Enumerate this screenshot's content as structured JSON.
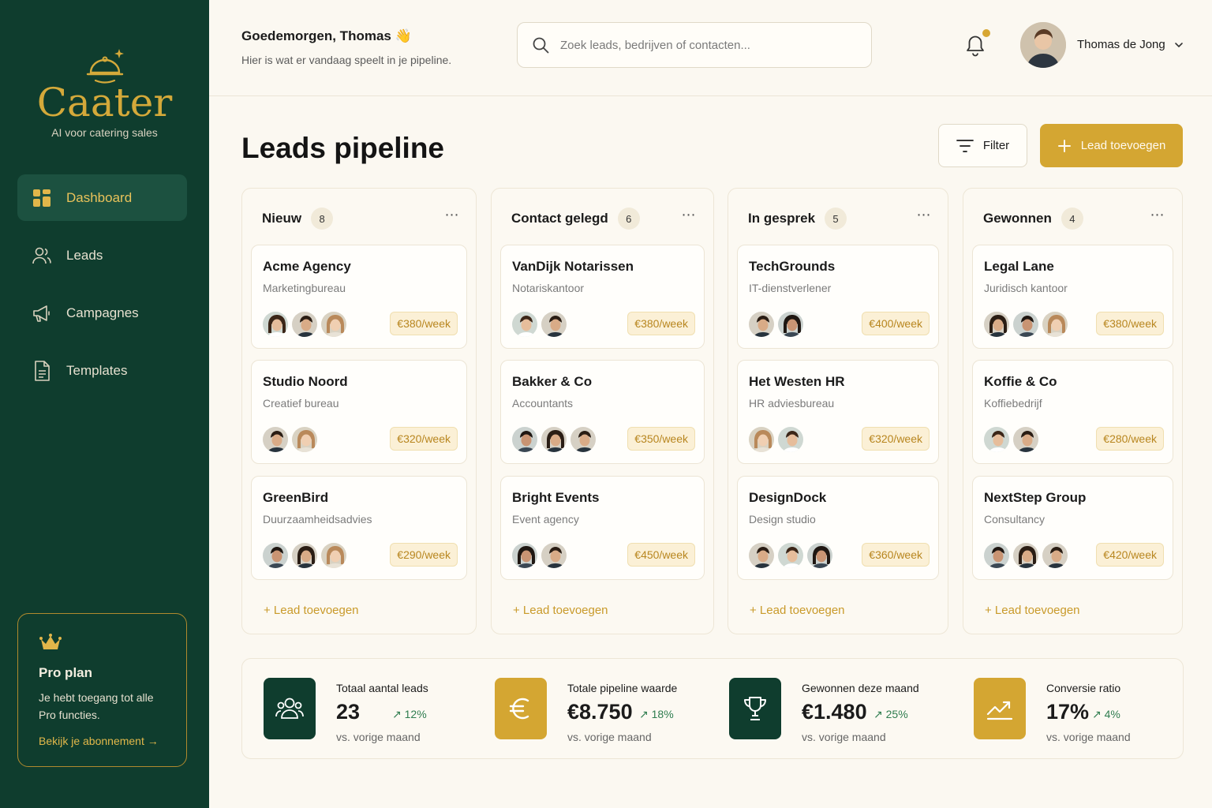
{
  "brand": {
    "name": "Caater",
    "tagline": "AI voor catering sales",
    "accent": "#d4a632",
    "sidebar_bg": "#0f3d2e"
  },
  "sidebar": {
    "items": [
      {
        "label": "Dashboard",
        "icon": "grid-icon",
        "active": true
      },
      {
        "label": "Leads",
        "icon": "users-icon",
        "active": false
      },
      {
        "label": "Campagnes",
        "icon": "megaphone-icon",
        "active": false
      },
      {
        "label": "Templates",
        "icon": "document-icon",
        "active": false
      }
    ],
    "pro": {
      "title": "Pro plan",
      "text": "Je hebt toegang tot alle Pro functies.",
      "link": "Bekijk je abonnement →"
    }
  },
  "header": {
    "greeting": "Goedemorgen, Thomas 👋",
    "subtitle": "Hier is wat er vandaag speelt in je pipeline.",
    "search_placeholder": "Zoek leads, bedrijven of contacten...",
    "user_name": "Thomas de Jong"
  },
  "page": {
    "title": "Leads pipeline",
    "filter_label": "Filter",
    "add_label": "Lead toevoegen"
  },
  "columns": [
    {
      "name": "Nieuw",
      "count": "8",
      "add_label": "+ Lead toevoegen",
      "cards": [
        {
          "name": "Acme Agency",
          "type": "Marketingbureau",
          "price": "€380/week"
        },
        {
          "name": "Studio Noord",
          "type": "Creatief bureau",
          "price": "€320/week"
        },
        {
          "name": "GreenBird",
          "type": "Duurzaamheidsadvies",
          "price": "€290/week"
        }
      ]
    },
    {
      "name": "Contact gelegd",
      "count": "6",
      "add_label": "+ Lead toevoegen",
      "cards": [
        {
          "name": "VanDijk Notarissen",
          "type": "Notariskantoor",
          "price": "€380/week"
        },
        {
          "name": "Bakker & Co",
          "type": "Accountants",
          "price": "€350/week"
        },
        {
          "name": "Bright Events",
          "type": "Event agency",
          "price": "€450/week"
        }
      ]
    },
    {
      "name": "In gesprek",
      "count": "5",
      "add_label": "+ Lead toevoegen",
      "cards": [
        {
          "name": "TechGrounds",
          "type": "IT-dienstverlener",
          "price": "€400/week"
        },
        {
          "name": "Het Westen HR",
          "type": "HR adviesbureau",
          "price": "€320/week"
        },
        {
          "name": "DesignDock",
          "type": "Design studio",
          "price": "€360/week"
        }
      ]
    },
    {
      "name": "Gewonnen",
      "count": "4",
      "add_label": "+ Lead toevoegen",
      "cards": [
        {
          "name": "Legal Lane",
          "type": "Juridisch kantoor",
          "price": "€380/week"
        },
        {
          "name": "Koffie & Co",
          "type": "Koffiebedrijf",
          "price": "€280/week"
        },
        {
          "name": "NextStep Group",
          "type": "Consultancy",
          "price": "€420/week"
        }
      ]
    }
  ],
  "stats": [
    {
      "label": "Totaal aantal leads",
      "value": "23",
      "delta": "↗ 12%",
      "sub": "vs. vorige maand",
      "icon": "users-icon"
    },
    {
      "label": "Totale pipeline waarde",
      "value": "€8.750",
      "delta": "↗ 18%",
      "sub": "vs. vorige maand",
      "icon": "euro-icon"
    },
    {
      "label": "Gewonnen deze maand",
      "value": "€1.480",
      "delta": "↗ 25%",
      "sub": "vs. vorige maand",
      "icon": "trophy-icon"
    },
    {
      "label": "Conversie ratio",
      "value": "17%",
      "delta": "↗ 4%",
      "sub": "vs. vorige maand",
      "icon": "trend-up-icon"
    }
  ]
}
